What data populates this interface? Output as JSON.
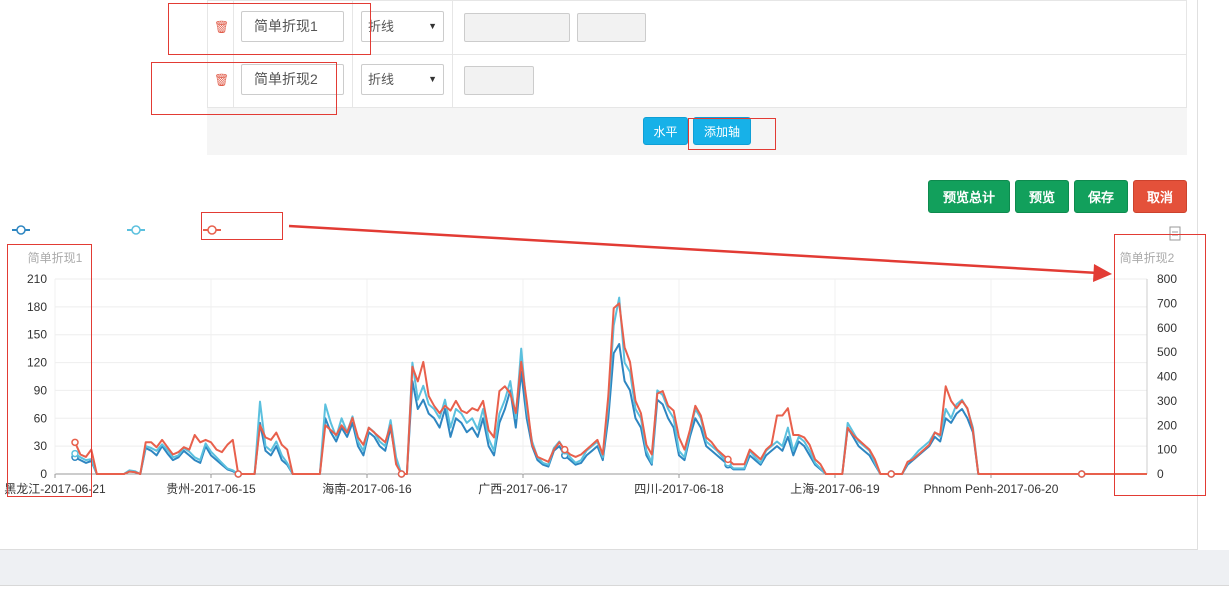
{
  "rows": [
    {
      "name_value": "简单折现1",
      "type_value": "折线"
    },
    {
      "name_value": "简单折现2",
      "type_value": "折线"
    }
  ],
  "footer_buttons": {
    "horizontal": "水平",
    "add_axis": "添加轴"
  },
  "actions": {
    "preview_total": "预览总计",
    "preview": "预览",
    "save": "保存",
    "cancel": "取消"
  },
  "colors": {
    "series1": "#2e86c1",
    "series2": "#5bc0de",
    "series3": "#e8604c",
    "annotation": "#e23b34",
    "green": "#12a05c",
    "red": "#e4513a",
    "cyan": "#17b1e8"
  },
  "chart_data": {
    "type": "line",
    "y_axis_left": {
      "name": "简单折现1",
      "ticks": [
        0,
        30,
        60,
        90,
        120,
        150,
        180,
        210
      ],
      "range": [
        0,
        210
      ]
    },
    "y_axis_right": {
      "name": "简单折现2",
      "ticks": [
        0,
        100,
        200,
        300,
        400,
        500,
        600,
        700,
        800
      ],
      "range": [
        0,
        800
      ]
    },
    "x_tick_labels": [
      "黑龙江-2017-06-21",
      "贵州-2017-06-15",
      "海南-2017-06-16",
      "广西-2017-06-17",
      "四川-2017-06-18",
      "上海-2017-06-19",
      "Phnom Penh-2017-06-20"
    ],
    "series": [
      {
        "axis": "left",
        "values": [
          18,
          15,
          12,
          14,
          0,
          0,
          0,
          0,
          0,
          0,
          3,
          2,
          0,
          28,
          25,
          20,
          30,
          22,
          15,
          18,
          25,
          20,
          15,
          12,
          30,
          20,
          15,
          10,
          5,
          3,
          0,
          0,
          0,
          0,
          55,
          25,
          20,
          30,
          15,
          10,
          0,
          0,
          0,
          0,
          0,
          0,
          60,
          45,
          35,
          50,
          40,
          55,
          30,
          20,
          45,
          40,
          30,
          25,
          50,
          15,
          0,
          0,
          100,
          70,
          80,
          65,
          60,
          50,
          70,
          40,
          60,
          55,
          45,
          50,
          40,
          60,
          30,
          20,
          55,
          70,
          90,
          50,
          110,
          60,
          30,
          15,
          10,
          8,
          25,
          30,
          20,
          15,
          10,
          12,
          20,
          25,
          30,
          15,
          60,
          130,
          140,
          100,
          90,
          60,
          50,
          20,
          10,
          80,
          75,
          60,
          50,
          20,
          15,
          40,
          60,
          50,
          30,
          25,
          20,
          15,
          10,
          5,
          5,
          5,
          20,
          15,
          10,
          20,
          25,
          30,
          25,
          40,
          20,
          35,
          30,
          20,
          10,
          5,
          0,
          0,
          0,
          0,
          50,
          40,
          30,
          25,
          20,
          10,
          0,
          0,
          0,
          0,
          0,
          10,
          15,
          20,
          25,
          30,
          40,
          35,
          60,
          55,
          65,
          70,
          60,
          45,
          0,
          0,
          0,
          0,
          0,
          0,
          0,
          0,
          0,
          0,
          0,
          0,
          0,
          0,
          0,
          0,
          0,
          0,
          0,
          0,
          0,
          0,
          0,
          0,
          0,
          0,
          0,
          0,
          0,
          0,
          0,
          0
        ]
      },
      {
        "axis": "left",
        "values": [
          22,
          18,
          15,
          16,
          0,
          0,
          0,
          0,
          0,
          0,
          4,
          3,
          0,
          30,
          28,
          25,
          32,
          26,
          18,
          20,
          28,
          24,
          18,
          15,
          33,
          24,
          18,
          12,
          6,
          4,
          0,
          0,
          0,
          0,
          78,
          30,
          25,
          35,
          20,
          12,
          0,
          0,
          0,
          0,
          0,
          0,
          75,
          55,
          40,
          60,
          45,
          62,
          35,
          25,
          50,
          45,
          35,
          30,
          58,
          18,
          0,
          0,
          120,
          80,
          95,
          75,
          70,
          60,
          80,
          50,
          70,
          65,
          55,
          60,
          48,
          70,
          38,
          25,
          65,
          80,
          100,
          60,
          135,
          70,
          35,
          18,
          12,
          10,
          28,
          35,
          25,
          18,
          12,
          15,
          25,
          30,
          35,
          18,
          75,
          160,
          190,
          120,
          110,
          70,
          60,
          25,
          12,
          90,
          85,
          70,
          60,
          25,
          18,
          45,
          70,
          60,
          35,
          30,
          25,
          18,
          12,
          6,
          6,
          6,
          25,
          18,
          12,
          25,
          30,
          35,
          30,
          50,
          25,
          40,
          35,
          25,
          12,
          6,
          0,
          0,
          0,
          0,
          55,
          45,
          35,
          30,
          25,
          12,
          0,
          0,
          0,
          0,
          0,
          12,
          18,
          25,
          30,
          35,
          45,
          40,
          70,
          60,
          75,
          80,
          70,
          50,
          0,
          0,
          0,
          0,
          0,
          0,
          0,
          0,
          0,
          0,
          0,
          0,
          0,
          0,
          0,
          0,
          0,
          0,
          0,
          0,
          0,
          0,
          0,
          0,
          0,
          0,
          0,
          0,
          0,
          0,
          0,
          0
        ]
      },
      {
        "axis": "right",
        "values": [
          130,
          80,
          70,
          100,
          0,
          0,
          0,
          0,
          0,
          0,
          10,
          8,
          0,
          130,
          130,
          110,
          140,
          110,
          80,
          90,
          110,
          100,
          160,
          130,
          140,
          130,
          100,
          90,
          120,
          140,
          0,
          0,
          0,
          0,
          200,
          150,
          140,
          170,
          120,
          100,
          0,
          0,
          0,
          0,
          0,
          0,
          200,
          180,
          160,
          200,
          170,
          230,
          150,
          120,
          190,
          170,
          150,
          130,
          200,
          40,
          0,
          0,
          440,
          380,
          460,
          320,
          280,
          250,
          280,
          260,
          300,
          260,
          250,
          270,
          260,
          300,
          180,
          150,
          340,
          360,
          330,
          250,
          460,
          300,
          120,
          70,
          60,
          50,
          100,
          130,
          100,
          80,
          70,
          80,
          100,
          120,
          140,
          80,
          320,
          680,
          700,
          520,
          460,
          300,
          250,
          120,
          80,
          330,
          340,
          280,
          260,
          150,
          100,
          180,
          280,
          240,
          150,
          130,
          100,
          80,
          60,
          40,
          40,
          40,
          100,
          80,
          60,
          100,
          120,
          240,
          240,
          270,
          160,
          160,
          150,
          120,
          60,
          40,
          0,
          0,
          0,
          0,
          190,
          160,
          140,
          120,
          100,
          60,
          0,
          0,
          0,
          0,
          0,
          50,
          60,
          80,
          100,
          120,
          170,
          160,
          360,
          300,
          270,
          300,
          270,
          180,
          0,
          0,
          0,
          0,
          0,
          0,
          0,
          0,
          0,
          0,
          0,
          0,
          0,
          0,
          0,
          0,
          0,
          0,
          0,
          0,
          0,
          0,
          0,
          0,
          0,
          0,
          0,
          0,
          0,
          0,
          0,
          0
        ]
      }
    ],
    "grid": true,
    "legend_placement": "top-left"
  }
}
